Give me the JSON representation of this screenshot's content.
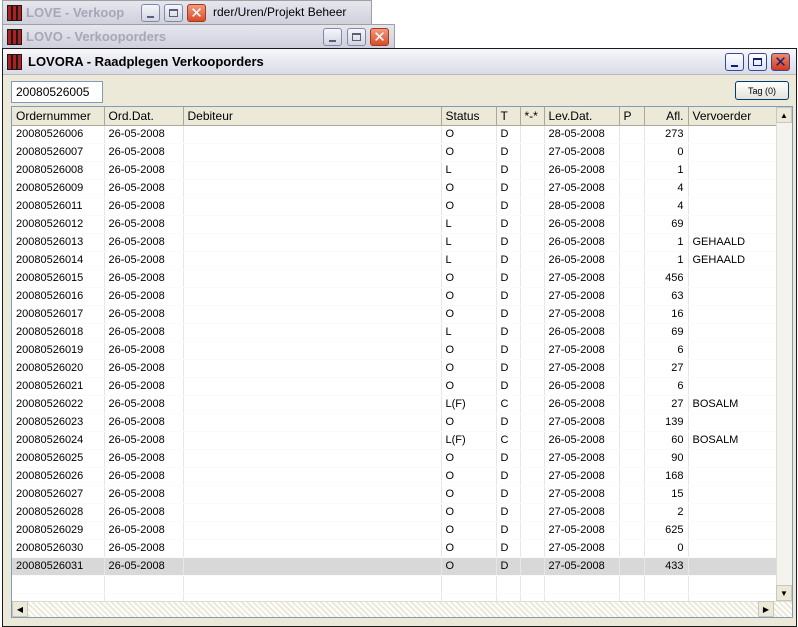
{
  "bg_window_1": {
    "title": "LOVE - Verkoop",
    "behind_title": "rder/Uren/Projekt Beheer"
  },
  "bg_window_2": {
    "title": "LOVO - Verkooporders"
  },
  "main_window": {
    "title": "LOVORA - Raadplegen Verkooporders"
  },
  "search": {
    "value": "20080526005"
  },
  "tag_button": {
    "label": "Tag (0)"
  },
  "columns": [
    "Ordernummer",
    "Ord.Dat.",
    "Debiteur",
    "Status",
    "T",
    "*-*",
    "Lev.Dat.",
    "P",
    "Afl.",
    "Vervoerder"
  ],
  "rows": [
    [
      "20080526006",
      "26-05-2008",
      "",
      "O",
      "D",
      "",
      "28-05-2008",
      "",
      "273",
      ""
    ],
    [
      "20080526007",
      "26-05-2008",
      "",
      "O",
      "D",
      "",
      "27-05-2008",
      "",
      "0",
      ""
    ],
    [
      "20080526008",
      "26-05-2008",
      "",
      "L",
      "D",
      "",
      "26-05-2008",
      "",
      "1",
      ""
    ],
    [
      "20080526009",
      "26-05-2008",
      "",
      "O",
      "D",
      "",
      "27-05-2008",
      "",
      "4",
      ""
    ],
    [
      "20080526011",
      "26-05-2008",
      "",
      "O",
      "D",
      "",
      "28-05-2008",
      "",
      "4",
      ""
    ],
    [
      "20080526012",
      "26-05-2008",
      "",
      "L",
      "D",
      "",
      "26-05-2008",
      "",
      "69",
      ""
    ],
    [
      "20080526013",
      "26-05-2008",
      "",
      "L",
      "D",
      "",
      "26-05-2008",
      "",
      "1",
      "GEHAALD"
    ],
    [
      "20080526014",
      "26-05-2008",
      "",
      "L",
      "D",
      "",
      "26-05-2008",
      "",
      "1",
      "GEHAALD"
    ],
    [
      "20080526015",
      "26-05-2008",
      "",
      "O",
      "D",
      "",
      "27-05-2008",
      "",
      "456",
      ""
    ],
    [
      "20080526016",
      "26-05-2008",
      "",
      "O",
      "D",
      "",
      "27-05-2008",
      "",
      "63",
      ""
    ],
    [
      "20080526017",
      "26-05-2008",
      "",
      "O",
      "D",
      "",
      "27-05-2008",
      "",
      "16",
      ""
    ],
    [
      "20080526018",
      "26-05-2008",
      "",
      "L",
      "D",
      "",
      "26-05-2008",
      "",
      "69",
      ""
    ],
    [
      "20080526019",
      "26-05-2008",
      "",
      "O",
      "D",
      "",
      "27-05-2008",
      "",
      "6",
      ""
    ],
    [
      "20080526020",
      "26-05-2008",
      "",
      "O",
      "D",
      "",
      "27-05-2008",
      "",
      "27",
      ""
    ],
    [
      "20080526021",
      "26-05-2008",
      "",
      "O",
      "D",
      "",
      "26-05-2008",
      "",
      "6",
      ""
    ],
    [
      "20080526022",
      "26-05-2008",
      "",
      "L(F)",
      "C",
      "",
      "26-05-2008",
      "",
      "27",
      "BOSALM"
    ],
    [
      "20080526023",
      "26-05-2008",
      "",
      "O",
      "D",
      "",
      "27-05-2008",
      "",
      "139",
      ""
    ],
    [
      "20080526024",
      "26-05-2008",
      "",
      "L(F)",
      "C",
      "",
      "26-05-2008",
      "",
      "60",
      "BOSALM"
    ],
    [
      "20080526025",
      "26-05-2008",
      "",
      "O",
      "D",
      "",
      "27-05-2008",
      "",
      "90",
      ""
    ],
    [
      "20080526026",
      "26-05-2008",
      "",
      "O",
      "D",
      "",
      "27-05-2008",
      "",
      "168",
      ""
    ],
    [
      "20080526027",
      "26-05-2008",
      "",
      "O",
      "D",
      "",
      "27-05-2008",
      "",
      "15",
      ""
    ],
    [
      "20080526028",
      "26-05-2008",
      "",
      "O",
      "D",
      "",
      "27-05-2008",
      "",
      "2",
      ""
    ],
    [
      "20080526029",
      "26-05-2008",
      "",
      "O",
      "D",
      "",
      "27-05-2008",
      "",
      "625",
      ""
    ],
    [
      "20080526030",
      "26-05-2008",
      "",
      "O",
      "D",
      "",
      "27-05-2008",
      "",
      "0",
      ""
    ],
    [
      "20080526031",
      "26-05-2008",
      "",
      "O",
      "D",
      "",
      "27-05-2008",
      "",
      "433",
      ""
    ]
  ],
  "selected_row": 24,
  "icons": {
    "app": "app-icon",
    "minimize": "minimize-icon",
    "maximize": "maximize-icon",
    "close": "close-icon",
    "scroll_up": "arrow-up-icon",
    "scroll_down": "arrow-down-icon",
    "scroll_left": "arrow-left-icon",
    "scroll_right": "arrow-right-icon"
  },
  "colors": {
    "close_button": "#d94d2a",
    "selected_row": "#d8d8d8",
    "window_body": "#ece9d8"
  }
}
